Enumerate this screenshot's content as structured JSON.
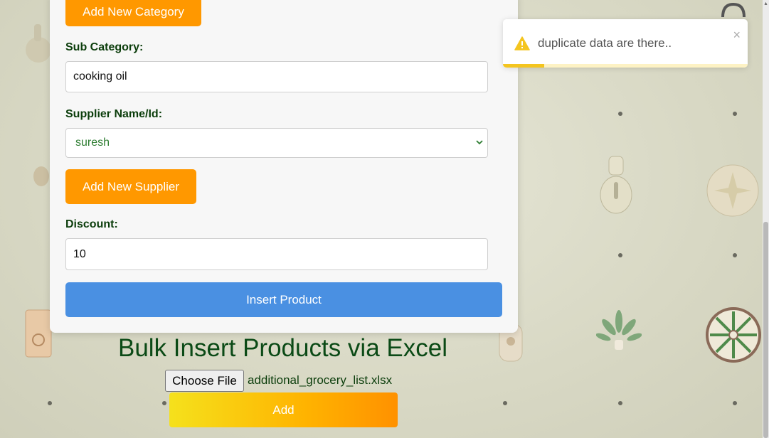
{
  "form": {
    "add_category_label": "Add New Category",
    "sub_category_label": "Sub Category:",
    "sub_category_value": "cooking oil",
    "supplier_label": "Supplier Name/Id:",
    "supplier_selected": "suresh",
    "add_supplier_label": "Add New Supplier",
    "discount_label": "Discount:",
    "discount_value": "10",
    "insert_label": "Insert Product"
  },
  "bulk": {
    "title": "Bulk Insert Products via Excel",
    "choose_file_label": "Choose File",
    "file_name": "additional_grocery_list.xlsx",
    "add_label": "Add"
  },
  "toast": {
    "message": "duplicate data are there..",
    "close_label": "×",
    "icon": "warning-icon",
    "progress": 0.17
  },
  "colors": {
    "orange": "#ff9800",
    "blue": "#4a90e2",
    "label_green": "#0b3d0b",
    "warning": "#f4c51f"
  }
}
